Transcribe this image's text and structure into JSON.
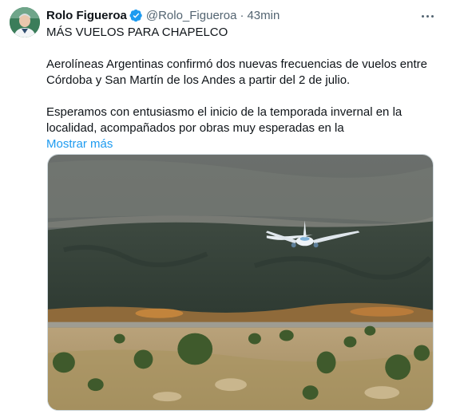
{
  "author": {
    "name": "Rolo Figueroa",
    "handle": "@Rolo_Figueroa",
    "separator": "·",
    "time": "43min"
  },
  "icons": {
    "verified": "verified-badge-icon",
    "more": "more-options-icon"
  },
  "colors": {
    "link": "#1d9bf0",
    "verified": "#1d9bf0",
    "secondary_text": "#536471"
  },
  "tweet": {
    "headline": "MÁS VUELOS PARA CHAPELCO",
    "paragraph1": "Aerolíneas Argentinas confirmó dos nuevas frecuencias de vuelos entre Córdoba y San Martín de los Andes a partir del 2 de julio.",
    "paragraph2": "Esperamos con entusiasmo el inicio de la temporada invernal en la localidad, acompañados por obras muy esperadas en la",
    "show_more": "Mostrar más"
  }
}
